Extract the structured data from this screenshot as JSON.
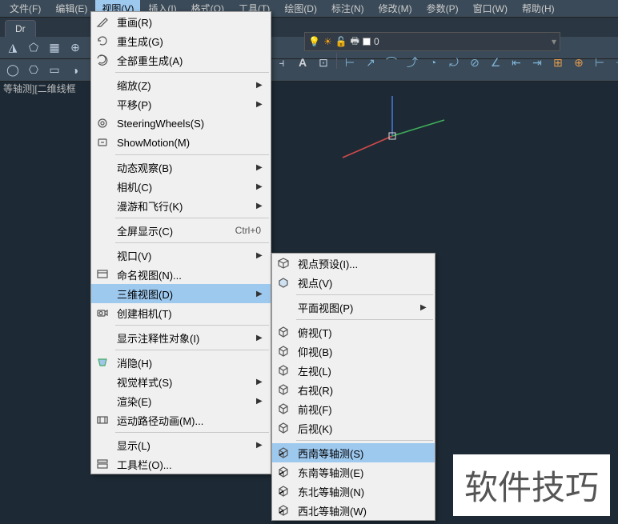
{
  "menubar": {
    "items": [
      {
        "label": "文件(F)"
      },
      {
        "label": "编辑(E)"
      },
      {
        "label": "视图(V)",
        "active": true
      },
      {
        "label": "插入(I)"
      },
      {
        "label": "格式(O)"
      },
      {
        "label": "工具(T)"
      },
      {
        "label": "绘图(D)"
      },
      {
        "label": "标注(N)"
      },
      {
        "label": "修改(M)"
      },
      {
        "label": "参数(P)"
      },
      {
        "label": "窗口(W)"
      },
      {
        "label": "帮助(H)"
      }
    ]
  },
  "tab": {
    "label": "Dr"
  },
  "status": "等轴测][二维线框",
  "layer": {
    "name": "0"
  },
  "view_menu": {
    "items": [
      {
        "icon": "pencil",
        "label": "重画(R)"
      },
      {
        "icon": "regen",
        "label": "重生成(G)"
      },
      {
        "icon": "regen-all",
        "label": "全部重生成(A)"
      },
      {
        "sep": true
      },
      {
        "label": "缩放(Z)",
        "arrow": true
      },
      {
        "label": "平移(P)",
        "arrow": true
      },
      {
        "icon": "wheel",
        "label": "SteeringWheels(S)"
      },
      {
        "icon": "motion",
        "label": "ShowMotion(M)"
      },
      {
        "sep": true
      },
      {
        "label": "动态观察(B)",
        "arrow": true
      },
      {
        "label": "相机(C)",
        "arrow": true
      },
      {
        "label": "漫游和飞行(K)",
        "arrow": true
      },
      {
        "sep": true
      },
      {
        "label": "全屏显示(C)",
        "shortcut": "Ctrl+0"
      },
      {
        "sep": true
      },
      {
        "label": "视口(V)",
        "arrow": true
      },
      {
        "icon": "named-view",
        "label": "命名视图(N)..."
      },
      {
        "label": "三维视图(D)",
        "arrow": true,
        "highlighted": true
      },
      {
        "icon": "camera",
        "label": "创建相机(T)"
      },
      {
        "sep": true
      },
      {
        "label": "显示注释性对象(I)",
        "arrow": true
      },
      {
        "sep": true
      },
      {
        "icon": "hide",
        "label": "消隐(H)"
      },
      {
        "label": "视觉样式(S)",
        "arrow": true
      },
      {
        "label": "渲染(E)",
        "arrow": true
      },
      {
        "icon": "anim",
        "label": "运动路径动画(M)..."
      },
      {
        "sep": true
      },
      {
        "label": "显示(L)",
        "arrow": true
      },
      {
        "icon": "toolbar",
        "label": "工具栏(O)..."
      }
    ]
  },
  "submenu": {
    "items": [
      {
        "icon": "vp-preset",
        "label": "视点预设(I)..."
      },
      {
        "icon": "vp",
        "label": "视点(V)"
      },
      {
        "sep": true
      },
      {
        "label": "平面视图(P)",
        "arrow": true
      },
      {
        "sep": true
      },
      {
        "icon": "cube",
        "label": "俯视(T)"
      },
      {
        "icon": "cube",
        "label": "仰视(B)"
      },
      {
        "icon": "cube",
        "label": "左视(L)"
      },
      {
        "icon": "cube",
        "label": "右视(R)"
      },
      {
        "icon": "cube",
        "label": "前视(F)"
      },
      {
        "icon": "cube",
        "label": "后视(K)"
      },
      {
        "sep": true
      },
      {
        "icon": "iso",
        "label": "西南等轴测(S)",
        "highlighted": true
      },
      {
        "icon": "iso",
        "label": "东南等轴测(E)"
      },
      {
        "icon": "iso",
        "label": "东北等轴测(N)"
      },
      {
        "icon": "iso",
        "label": "西北等轴测(W)"
      }
    ]
  },
  "watermark": "软件技巧"
}
